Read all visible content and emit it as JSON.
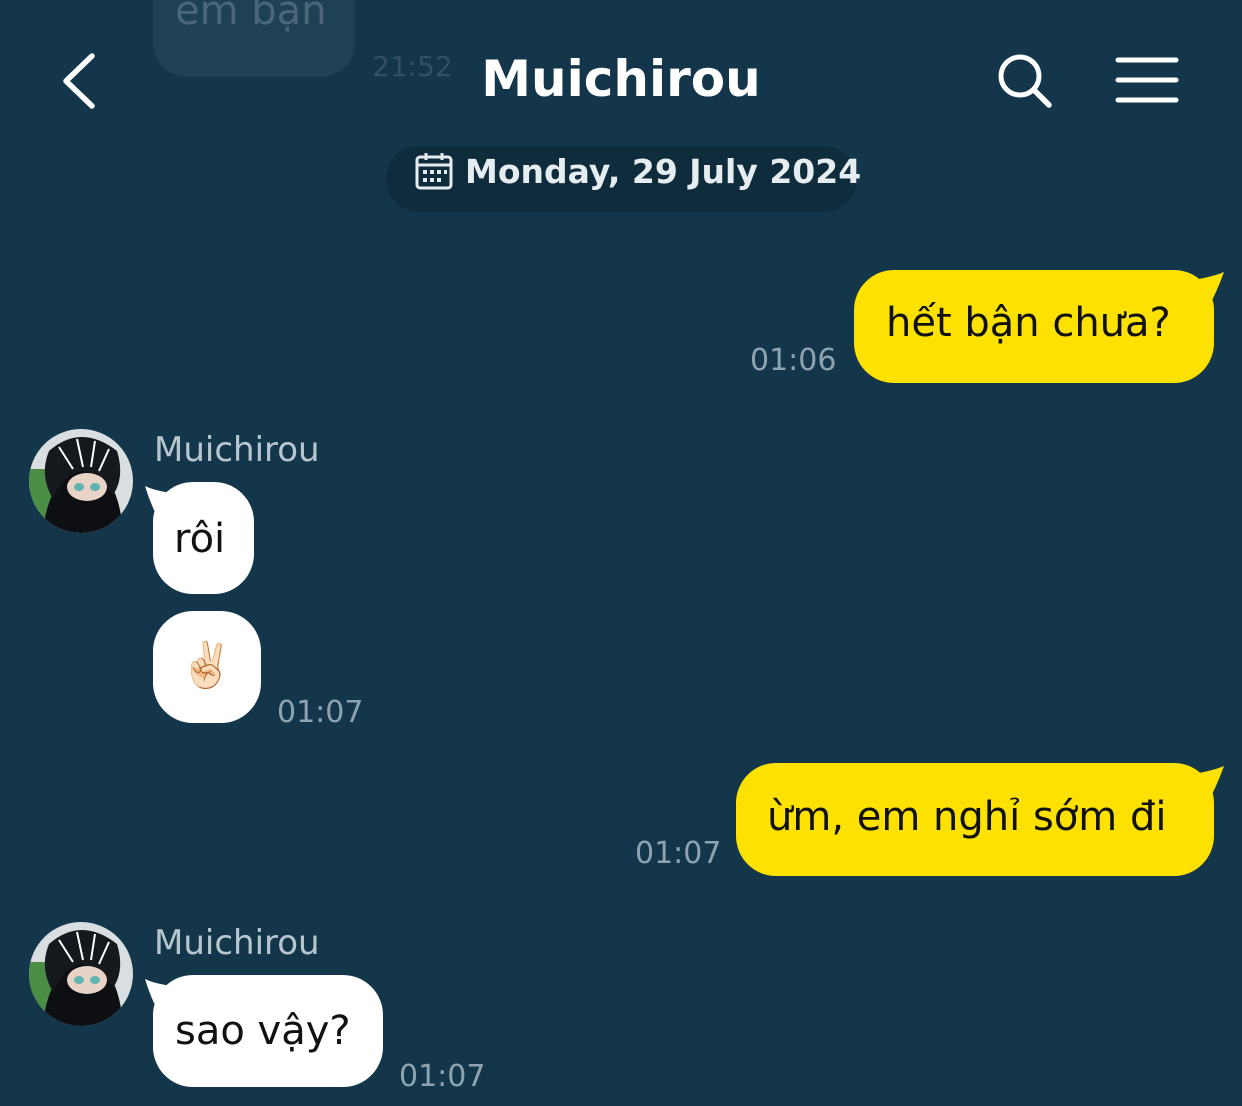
{
  "previous_message": {
    "text": "em bận",
    "time": "21:52"
  },
  "header": {
    "title": "Muichirou",
    "back_icon": "chevron-left-icon",
    "search_icon": "search-icon",
    "menu_icon": "hamburger-menu-icon"
  },
  "date_separator": {
    "icon": "calendar-icon",
    "label": "Monday, 29 July 2024"
  },
  "messages": [
    {
      "direction": "out",
      "text": "hết bận chưa?",
      "time": "01:06"
    },
    {
      "direction": "in",
      "sender": "Muichirou",
      "text": "rôi"
    },
    {
      "direction": "in",
      "text": "✌🏻",
      "time": "01:07"
    },
    {
      "direction": "out",
      "text": "ừm, em nghỉ sớm đi",
      "time": "01:07"
    },
    {
      "direction": "in",
      "sender": "Muichirou",
      "text": "sao vậy?",
      "time": "01:07"
    }
  ],
  "colors": {
    "background": "#13364b",
    "outgoing_bubble": "#fde101",
    "incoming_bubble": "#ffffff",
    "timestamp": "#8da3b0"
  }
}
